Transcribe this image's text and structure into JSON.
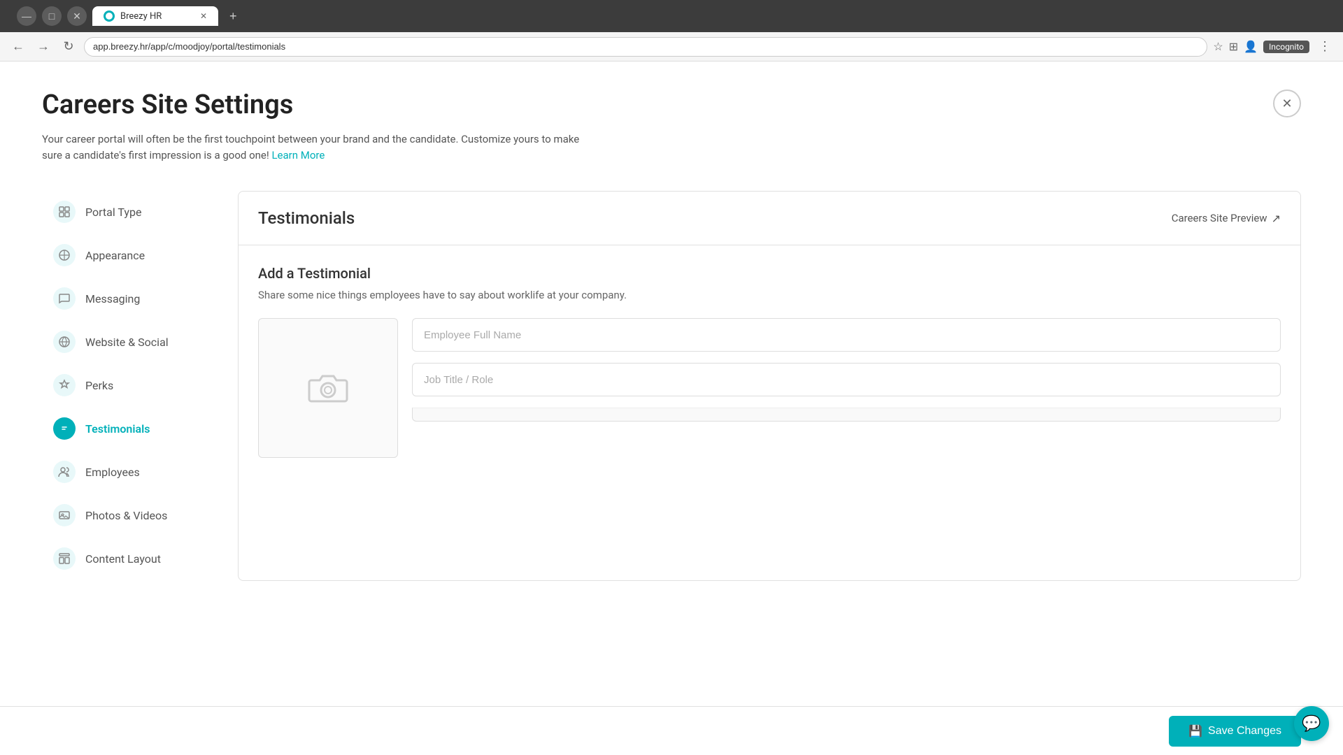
{
  "browser": {
    "tab_title": "Breezy HR",
    "address": "app.breezy.hr/app/c/moodjoy/portal/testimonials",
    "incognito_label": "Incognito"
  },
  "page": {
    "title": "Careers Site Settings",
    "subtitle": "Your career portal will often be the first touchpoint between your brand and the candidate. Customize yours to make sure a candidate's first impression is a good one!",
    "learn_more": "Learn More"
  },
  "sidebar": {
    "items": [
      {
        "id": "portal-type",
        "label": "Portal Type",
        "active": false
      },
      {
        "id": "appearance",
        "label": "Appearance",
        "active": false
      },
      {
        "id": "messaging",
        "label": "Messaging",
        "active": false
      },
      {
        "id": "website-social",
        "label": "Website & Social",
        "active": false
      },
      {
        "id": "perks",
        "label": "Perks",
        "active": false
      },
      {
        "id": "testimonials",
        "label": "Testimonials",
        "active": true
      },
      {
        "id": "employees",
        "label": "Employees",
        "active": false
      },
      {
        "id": "photos-videos",
        "label": "Photos & Videos",
        "active": false
      },
      {
        "id": "content-layout",
        "label": "Content Layout",
        "active": false
      }
    ]
  },
  "content": {
    "title": "Testimonials",
    "preview_label": "Careers Site Preview",
    "add_title": "Add a Testimonial",
    "add_desc": "Share some nice things employees have to say about worklife at your company.",
    "form": {
      "name_placeholder": "Employee Full Name",
      "role_placeholder": "Job Title / Role"
    }
  },
  "footer": {
    "save_label": "Save Changes"
  }
}
